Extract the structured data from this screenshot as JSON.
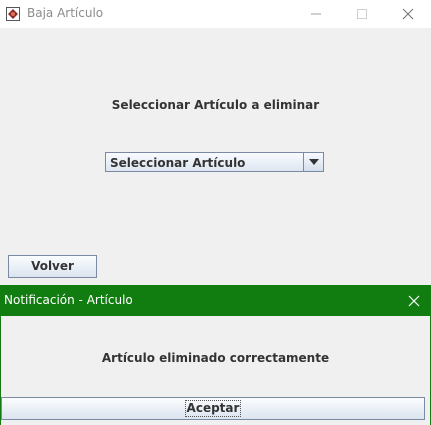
{
  "window": {
    "title": "Baja Artículo",
    "icons": {
      "app": "app-icon",
      "minimize": "minimize-icon",
      "maximize": "maximize-icon",
      "close": "close-icon"
    }
  },
  "form": {
    "label": "Seleccionar Artículo a eliminar",
    "combo_value": "Seleccionar Artículo",
    "back_button": "Volver"
  },
  "dialog": {
    "title": "Notificación - Artículo",
    "message": "Artículo eliminado correctamente",
    "ok_button": "Aceptar",
    "titlebar_color": "#117d11"
  }
}
